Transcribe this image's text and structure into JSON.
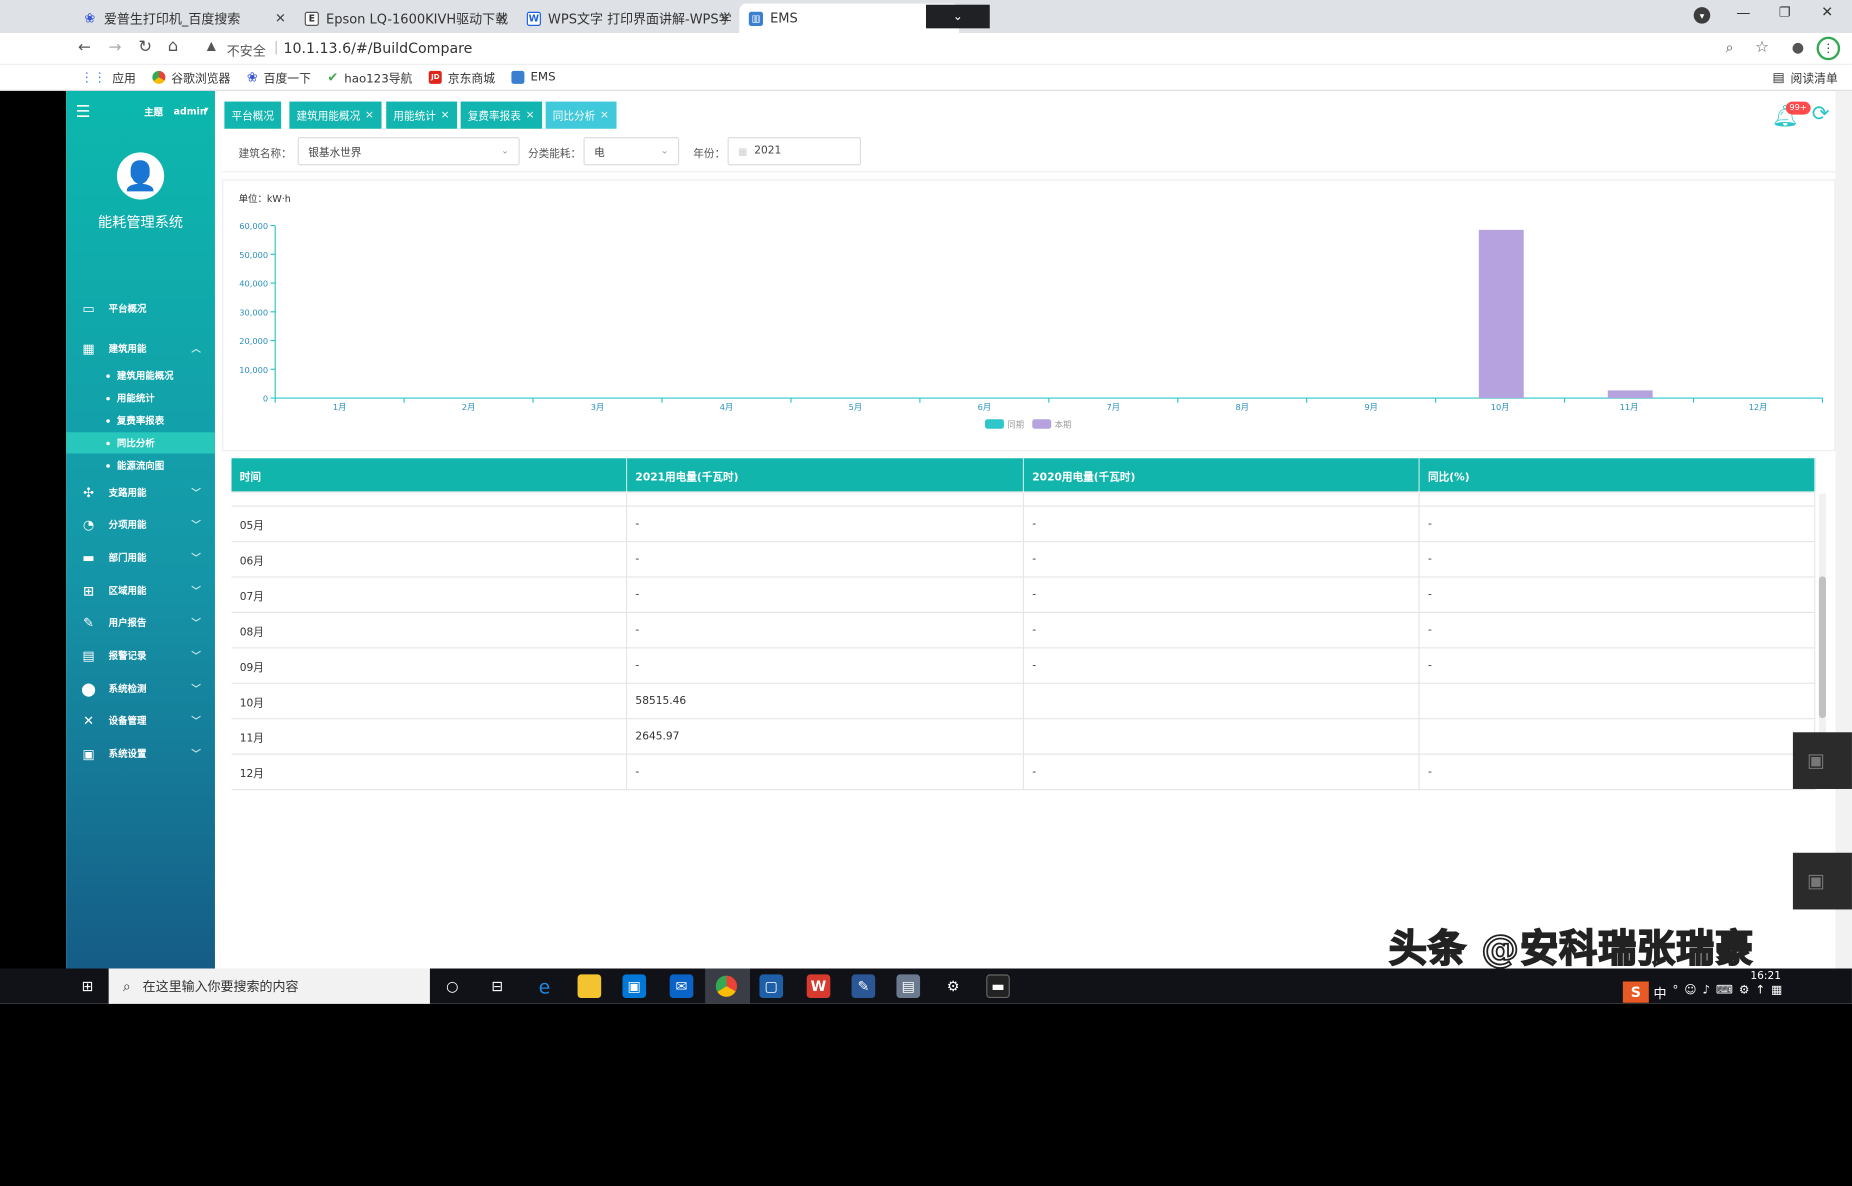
{
  "browser": {
    "tabs": [
      {
        "title": "爱普生打印机_百度搜索",
        "icon": "baidu-paw-icon",
        "color": "#3a55d8"
      },
      {
        "title": "Epson LQ-1600KIVH驱动下载",
        "icon": "epson-e-icon",
        "color": "#333333"
      },
      {
        "title": "WPS文字 打印界面讲解-WPS学",
        "icon": "wps-w-icon",
        "color": "#1c63d8"
      },
      {
        "title": "EMS",
        "icon": "ems-chart-icon",
        "color": "#3a7fd0"
      }
    ],
    "security_label": "不安全",
    "url": "10.1.13.6/#/BuildCompare",
    "bookmarks": [
      {
        "label": "应用",
        "icon": "apps-grid-icon",
        "color": "#4285f4"
      },
      {
        "label": "谷歌浏览器",
        "icon": "chrome-icon",
        "color": "#34a853"
      },
      {
        "label": "百度一下",
        "icon": "baidu-paw-icon",
        "color": "#3a55d8"
      },
      {
        "label": "hao123导航",
        "icon": "hao123-icon",
        "color": "#40a84a"
      },
      {
        "label": "京东商城",
        "icon": "jd-icon",
        "color": "#e1251b"
      },
      {
        "label": "EMS",
        "icon": "ems-chart-icon",
        "color": "#3a7fd0"
      }
    ],
    "reading_list": "阅读清单"
  },
  "header": {
    "theme_label": "主题",
    "user": "admin"
  },
  "sidebar": {
    "system_name": "能耗管理系统",
    "items": [
      {
        "label": "平台概况",
        "icon": "monitor-icon",
        "has_children": false
      },
      {
        "label": "建筑用能",
        "icon": "building-icon",
        "has_children": true
      },
      {
        "label": "支路用能",
        "icon": "branch-icon",
        "has_children": true
      },
      {
        "label": "分项用能",
        "icon": "compass-icon",
        "has_children": true
      },
      {
        "label": "部门用能",
        "icon": "folder-icon",
        "has_children": true
      },
      {
        "label": "区域用能",
        "icon": "region-grid-icon",
        "has_children": true
      },
      {
        "label": "用户报告",
        "icon": "edit-report-icon",
        "has_children": true
      },
      {
        "label": "报警记录",
        "icon": "alarm-doc-icon",
        "has_children": true
      },
      {
        "label": "系统检测",
        "icon": "location-pin-icon",
        "has_children": true
      },
      {
        "label": "设备管理",
        "icon": "tools-icon",
        "has_children": true
      },
      {
        "label": "系统设置",
        "icon": "settings-screen-icon",
        "has_children": true
      }
    ],
    "sub_items": [
      "建筑用能概况",
      "用能统计",
      "复费率报表",
      "同比分析",
      "能源流向图"
    ],
    "active_sub": "同比分析"
  },
  "page_tabs": [
    {
      "label": "平台概况",
      "closable": false
    },
    {
      "label": "建筑用能概况",
      "closable": true
    },
    {
      "label": "用能统计",
      "closable": true
    },
    {
      "label": "复费率报表",
      "closable": true
    },
    {
      "label": "同比分析",
      "closable": true
    }
  ],
  "notification_badge": "99+",
  "filters": {
    "building_label": "建筑名称：",
    "building_value": "银基水世界",
    "category_label": "分类能耗：",
    "category_value": "电",
    "year_label": "年份：",
    "year_value": "2021"
  },
  "chart_data": {
    "type": "bar",
    "unit_label": "单位：kW·h",
    "categories": [
      "1月",
      "2月",
      "3月",
      "4月",
      "5月",
      "6月",
      "7月",
      "8月",
      "9月",
      "10月",
      "11月",
      "12月"
    ],
    "series": [
      {
        "name": "同期",
        "color": "#2ec7c9",
        "values": [
          0,
          0,
          0,
          0,
          0,
          0,
          0,
          0,
          0,
          0,
          0,
          0
        ]
      },
      {
        "name": "本期",
        "color": "#b6a2de",
        "values": [
          0,
          0,
          0,
          0,
          0,
          0,
          0,
          0,
          0,
          58515.46,
          2645.97,
          0
        ]
      }
    ],
    "ylim": [
      0,
      60000
    ],
    "yticks": [
      "0",
      "10,000",
      "20,000",
      "30,000",
      "40,000",
      "50,000",
      "60,000"
    ],
    "legend_position": "bottom-center"
  },
  "table": {
    "headers": [
      "时间",
      "2021用电量(千瓦时)",
      "2020用电量(千瓦时)",
      "同比(%)"
    ],
    "rows": [
      [
        "05月",
        "-",
        "-",
        "-"
      ],
      [
        "06月",
        "-",
        "-",
        "-"
      ],
      [
        "07月",
        "-",
        "-",
        "-"
      ],
      [
        "08月",
        "-",
        "-",
        "-"
      ],
      [
        "09月",
        "-",
        "-",
        "-"
      ],
      [
        "10月",
        "58515.46",
        "",
        ""
      ],
      [
        "11月",
        "2645.97",
        "",
        ""
      ],
      [
        "12月",
        "-",
        "-",
        "-"
      ]
    ]
  },
  "taskbar": {
    "search_placeholder": "在这里输入你要搜索的内容",
    "clock": "16:21",
    "ime": "中"
  },
  "watermark": "头条 @安科瑞张瑞豪"
}
